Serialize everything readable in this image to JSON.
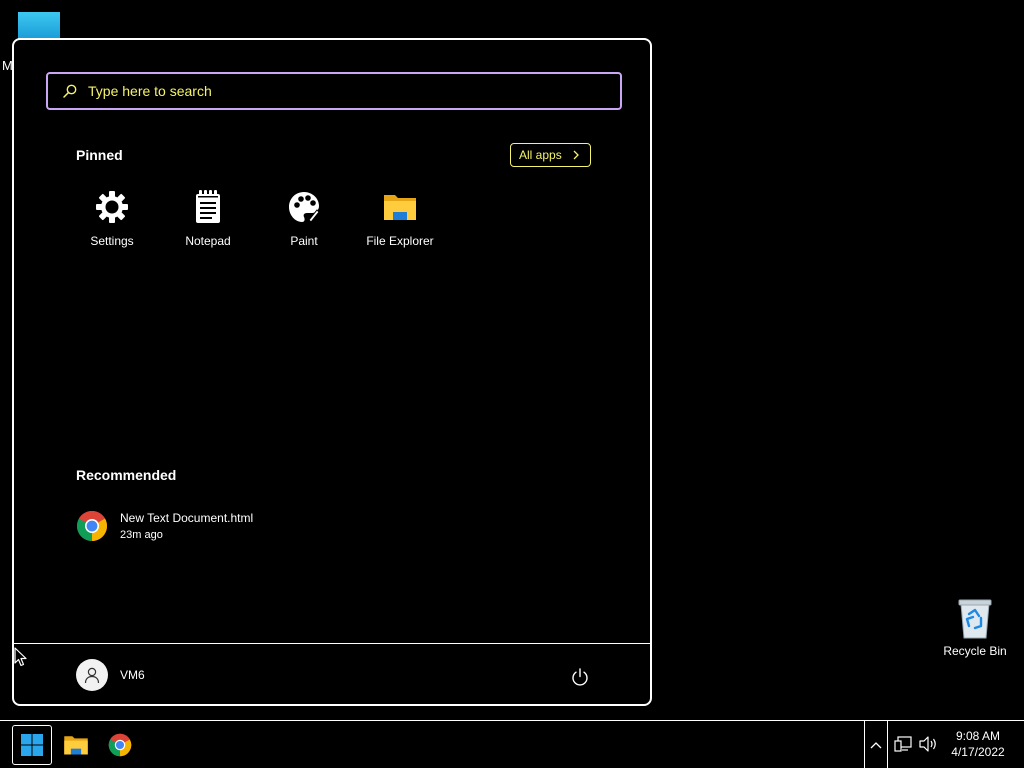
{
  "desktop": {
    "partial_label_fragment": "M",
    "recycle_bin_label": "Recycle Bin"
  },
  "start_menu": {
    "search": {
      "placeholder": "Type here to search",
      "value": "",
      "icon": "search-icon"
    },
    "pinned": {
      "title": "Pinned",
      "all_apps_label": "All apps",
      "apps": [
        {
          "label": "Settings",
          "icon": "gear-icon"
        },
        {
          "label": "Notepad",
          "icon": "notepad-icon"
        },
        {
          "label": "Paint",
          "icon": "palette-icon"
        },
        {
          "label": "File Explorer",
          "icon": "folder-icon"
        }
      ]
    },
    "recommended": {
      "title": "Recommended",
      "items": [
        {
          "name": "New Text Document.html",
          "time": "23m ago",
          "icon": "chrome-icon"
        }
      ]
    },
    "user": {
      "name": "VM6",
      "icon": "user-icon"
    },
    "power_icon": "power-icon"
  },
  "taskbar": {
    "items": [
      "start",
      "file-explorer",
      "chrome"
    ],
    "clock": {
      "time": "9:08 AM",
      "date": "4/17/2022"
    }
  },
  "colors": {
    "accent_search_border": "#c9a7f5",
    "accent_text": "#f5f36b",
    "background": "#000000",
    "foreground": "#ffffff"
  }
}
